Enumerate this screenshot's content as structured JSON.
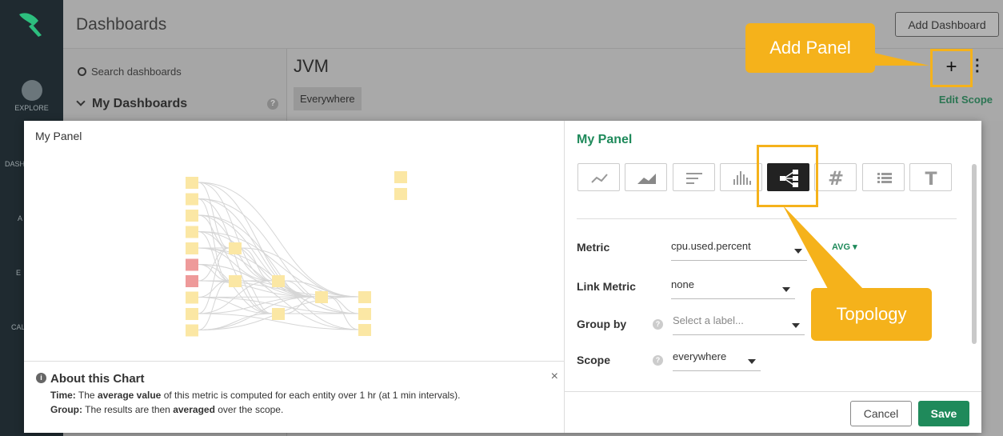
{
  "nav": {
    "items": [
      {
        "label": "EXPLORE"
      },
      {
        "label": "DASH"
      },
      {
        "label": "A"
      },
      {
        "label": "E"
      },
      {
        "label": "CAL"
      }
    ]
  },
  "topbar": {
    "title": "Dashboards",
    "add_dashboard": "Add Dashboard"
  },
  "sidebar": {
    "search_placeholder": "Search dashboards",
    "section": "My Dashboards",
    "help": "?"
  },
  "main": {
    "title": "JVM",
    "scope_chip": "Everywhere",
    "edit_scope": "Edit Scope",
    "add_panel": "+",
    "more": "⋮"
  },
  "callouts": {
    "add_panel": "Add Panel",
    "topology": "Topology"
  },
  "modal": {
    "preview_title": "My Panel",
    "about": {
      "title": "About this Chart",
      "time_label": "Time:",
      "time_pre": "The",
      "time_bold": "average value",
      "time_post": "of this metric is computed for each entity over 1 hr (at 1 min intervals).",
      "group_label": "Group:",
      "group_pre": "The results are then",
      "group_bold": "averaged",
      "group_post": "over the scope.",
      "close": "×"
    },
    "config": {
      "title": "My Panel",
      "viz_types": [
        {
          "name": "line-chart-icon"
        },
        {
          "name": "area-chart-icon"
        },
        {
          "name": "toplist-icon"
        },
        {
          "name": "histogram-icon"
        },
        {
          "name": "topology-icon",
          "selected": true
        },
        {
          "name": "number-icon"
        },
        {
          "name": "table-icon"
        },
        {
          "name": "text-icon"
        }
      ],
      "metric_label": "Metric",
      "metric_value": "cpu.used.percent",
      "aggregation": "AVG ▾",
      "link_metric_label": "Link Metric",
      "link_metric_value": "none",
      "group_by_label": "Group by",
      "group_by_placeholder": "Select a label...",
      "scope_label": "Scope",
      "scope_value": "everywhere",
      "help": "?",
      "cancel": "Cancel",
      "save": "Save"
    },
    "colors": {
      "node": "#fbe7a4",
      "node_alert": "#ee9a9a",
      "accent": "#1f8a5b",
      "callout": "#f5b21b"
    }
  }
}
